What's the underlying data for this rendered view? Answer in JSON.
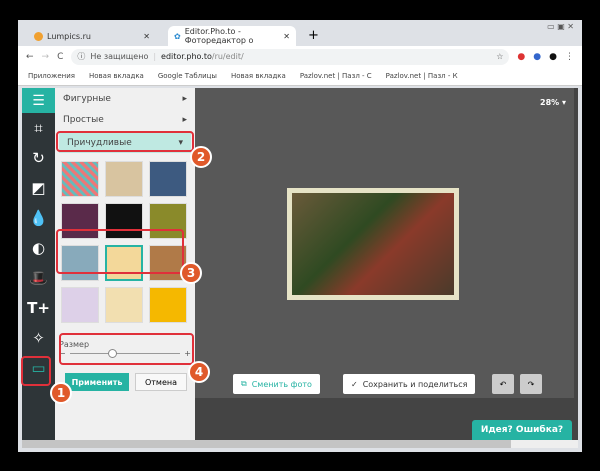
{
  "tabs": [
    {
      "title": "Lumpics.ru"
    },
    {
      "title": "Editor.Pho.to - Фоторедактор о"
    }
  ],
  "address": {
    "security": "Не защищено",
    "url_host": "editor.pho.to",
    "url_path": "/ru/edit/"
  },
  "bookmarks": [
    "Приложения",
    "Новая вкладка",
    "Google Таблицы",
    "Новая вкладка",
    "Pazlov.net | Пазл - С",
    "Pazlov.net | Пазл - К"
  ],
  "panel": {
    "items": [
      "Фигурные",
      "Простые"
    ],
    "selected": "Причудливые",
    "size_label": "Размер",
    "apply": "Применить",
    "cancel": "Отмена"
  },
  "canvas": {
    "zoom": "28%",
    "change_photo": "Сменить фото",
    "save_share": "Сохранить и поделиться"
  },
  "feedback": "Идея? Ошибка?",
  "badges": [
    "1",
    "2",
    "3",
    "4"
  ],
  "slider": {
    "value": 0.35
  },
  "colors": {
    "accent": "#26b3a3",
    "badge": "#e0592a",
    "highlight": "#e0303a"
  }
}
